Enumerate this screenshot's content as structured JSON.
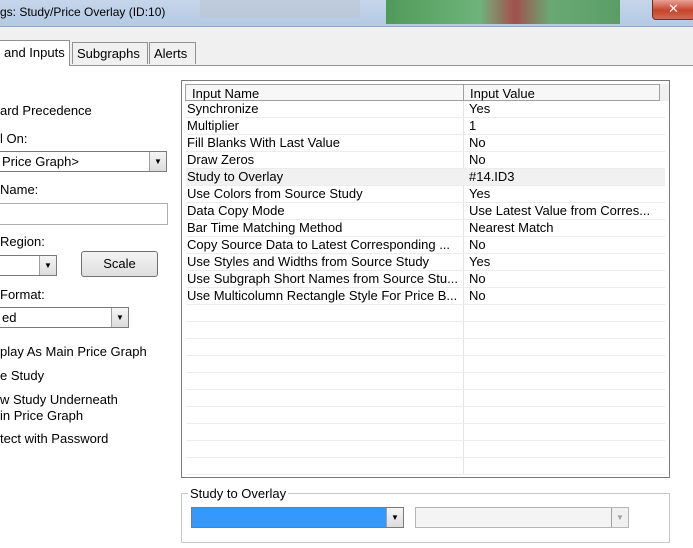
{
  "window": {
    "title": "gs: Study/Price Overlay (ID:10)",
    "close_label": "✕"
  },
  "tabs": [
    {
      "label": "and Inputs",
      "active": true
    },
    {
      "label": "Subgraphs",
      "active": false
    },
    {
      "label": "Alerts",
      "active": false
    }
  ],
  "left": {
    "precedence_label": "ard Precedence",
    "based_on_label": "l On:",
    "based_on_value": "Price Graph>",
    "name_label": "Name:",
    "name_value": "",
    "region_label": "Region:",
    "region_value": "",
    "scale_button": "Scale",
    "format_label": "Format:",
    "format_value": "ed",
    "check_display_main": "play As Main Price Graph",
    "check_hide_study": "e Study",
    "check_draw_underneath_1": "w Study Underneath",
    "check_draw_underneath_2": "in Price Graph",
    "check_protect": "tect with Password"
  },
  "grid": {
    "columns": [
      "Input Name",
      "Input Value"
    ],
    "rows": [
      {
        "name": "Synchronize",
        "value": "Yes"
      },
      {
        "name": "Multiplier",
        "value": "1"
      },
      {
        "name": "Fill Blanks With Last Value",
        "value": "No"
      },
      {
        "name": "Draw Zeros",
        "value": "No"
      },
      {
        "name": "Study to Overlay",
        "value": "#14.ID3"
      },
      {
        "name": "Use Colors from Source Study",
        "value": "Yes"
      },
      {
        "name": "Data Copy Mode",
        "value": "Use Latest Value from Corres..."
      },
      {
        "name": "Bar Time Matching Method",
        "value": "Nearest Match"
      },
      {
        "name": "Copy Source Data to Latest Corresponding ...",
        "value": "No"
      },
      {
        "name": "Use Styles and Widths from Source Study",
        "value": "Yes"
      },
      {
        "name": "Use Subgraph Short Names from Source Stu...",
        "value": "No"
      },
      {
        "name": "Use Multicolumn Rectangle Style For Price B...",
        "value": "No"
      }
    ]
  },
  "groupbox": {
    "label": "Study to Overlay",
    "combo1_value": "",
    "combo2_value": ""
  },
  "colors": {
    "selected_blue": "#3399ff",
    "title_bar": "#b4c9e4",
    "close_red": "#c7432b"
  }
}
